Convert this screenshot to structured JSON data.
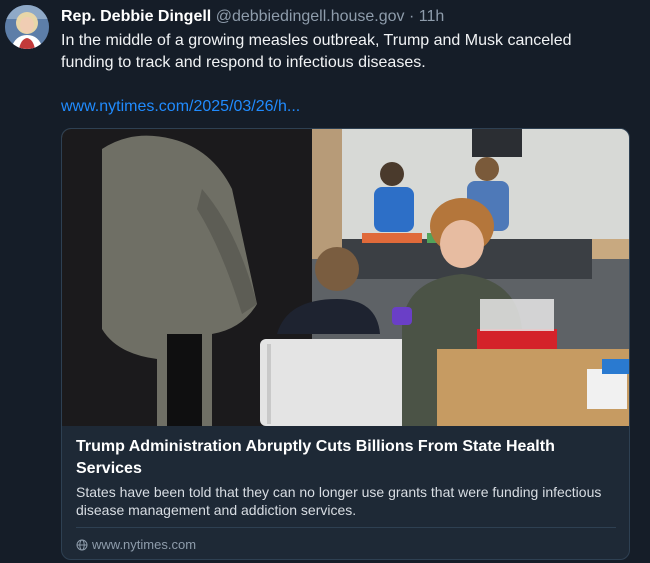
{
  "post": {
    "author_name": "Rep. Debbie Dingell",
    "handle": "@debbiedingell.house.gov",
    "separator": "·",
    "time": "11h",
    "text": "In the middle of a growing measles outbreak, Trump and Musk canceled funding to track and respond to infectious diseases.",
    "link_text": "www.nytimes.com/2025/03/26/h..."
  },
  "card": {
    "title": "Trump Administration Abruptly Cuts Billions From State Health Services",
    "description": "States have been told that they can no longer use grants that were funding infectious disease management and addiction services.",
    "domain": "www.nytimes.com"
  },
  "icons": {
    "avatar": "avatar-photo",
    "domain": "globe-icon"
  },
  "colors": {
    "background": "#151d28",
    "link": "#208bfe",
    "muted": "#8e9cab"
  }
}
